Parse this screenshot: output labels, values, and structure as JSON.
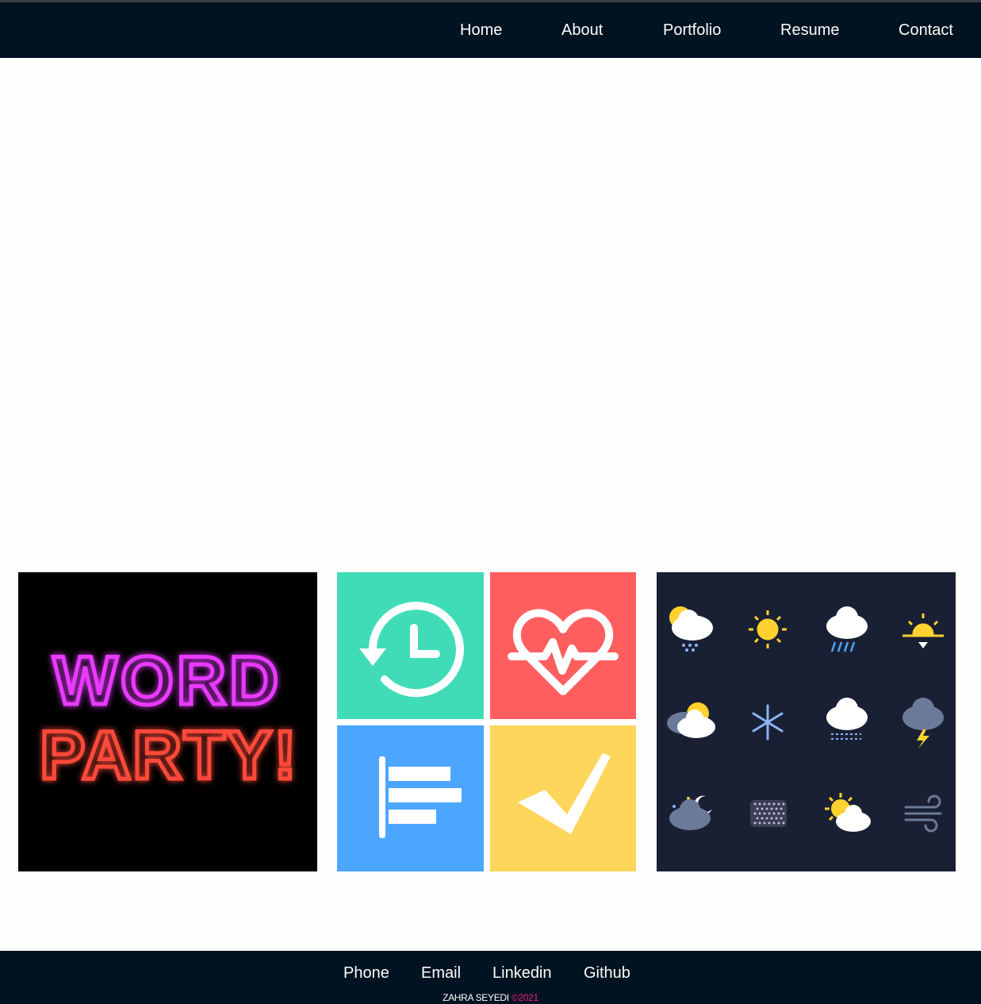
{
  "nav": {
    "items": [
      {
        "label": "Home"
      },
      {
        "label": "About"
      },
      {
        "label": "Portfolio"
      },
      {
        "label": "Resume"
      },
      {
        "label": "Contact"
      }
    ]
  },
  "projects": [
    {
      "name": "word-party",
      "text_line1": "WORD",
      "text_line2": "PARTY!"
    },
    {
      "name": "habit-tracker"
    },
    {
      "name": "weather-dashboard"
    }
  ],
  "footer": {
    "links": [
      {
        "label": "Phone"
      },
      {
        "label": "Email"
      },
      {
        "label": "Linkedin"
      },
      {
        "label": "Github"
      }
    ],
    "author": "ZAHRA SEYEDI",
    "year": "©2021"
  },
  "colors": {
    "nav_bg": "#011221",
    "page_bg": "#fdfffc",
    "accent": "#e91e7a"
  }
}
